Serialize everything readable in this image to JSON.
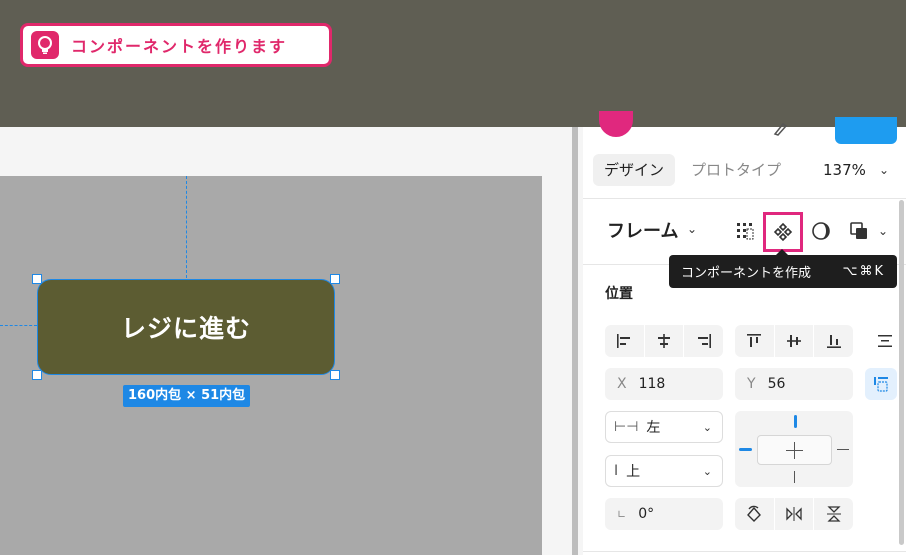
{
  "tip": {
    "text": "コンポーネントを作ります",
    "icon": "lightbulb-icon"
  },
  "canvas": {
    "button_text": "レジに進む",
    "size_label": "160内包 × 51内包"
  },
  "panel": {
    "tabs": [
      {
        "label": "デザイン",
        "active": true
      },
      {
        "label": "プロトタイプ",
        "active": false
      }
    ],
    "zoom": "137%",
    "frame_label": "フレーム",
    "tools": [
      "layout-grid-icon",
      "component-icon",
      "mask-icon",
      "boolean-icon"
    ],
    "tooltip": {
      "text": "コンポーネントを作成",
      "shortcut": "⌥⌘K"
    },
    "position_section": "位置",
    "x_label": "X",
    "x_value": "118",
    "y_label": "Y",
    "y_value": "56",
    "horizontal_constraint": "左",
    "vertical_constraint": "上",
    "rotation": "0°"
  },
  "colors": {
    "accent": "#e0286b",
    "selection": "#1e88e5",
    "button_fill": "#5c5c32",
    "top_band": "#5f5e53"
  }
}
